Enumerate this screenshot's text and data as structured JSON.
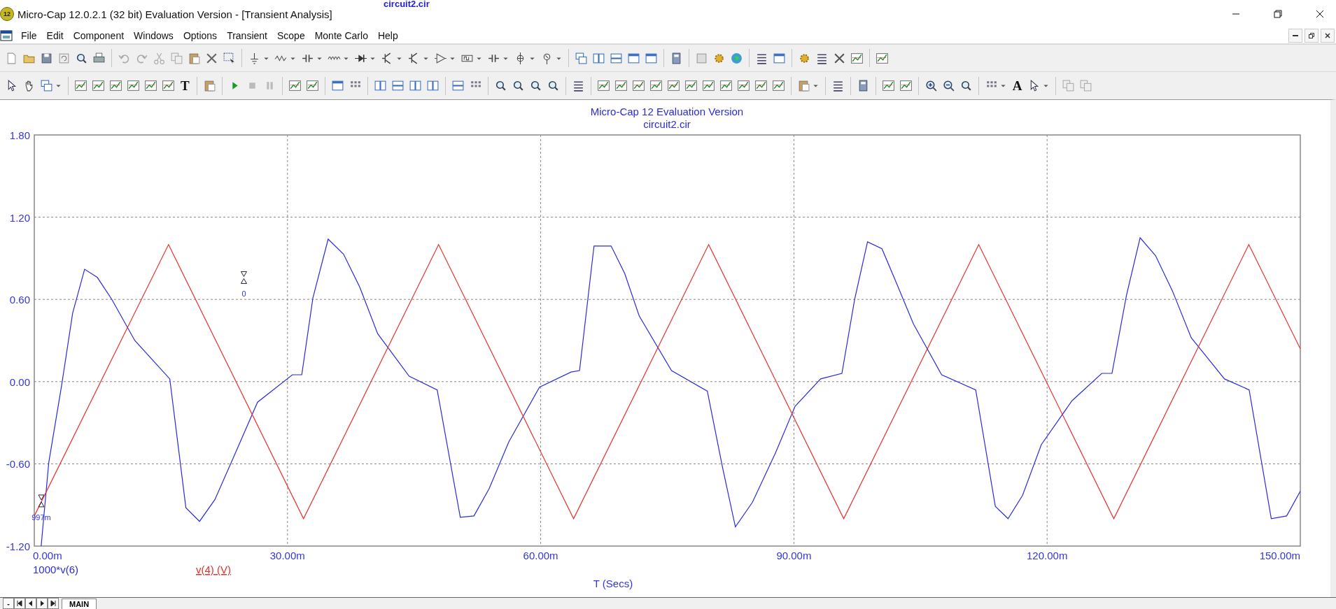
{
  "window": {
    "title": "Micro-Cap 12.0.2.1 (32 bit) Evaluation Version - [Transient Analysis]",
    "icon_label": "12",
    "overflow_text": "circuit2.cir"
  },
  "menu": [
    "File",
    "Edit",
    "Component",
    "Windows",
    "Options",
    "Transient",
    "Scope",
    "Monte Carlo",
    "Help"
  ],
  "toolbar_labels": [
    "T",
    "A"
  ],
  "plot": {
    "title": "Micro-Cap 12 Evaluation Version",
    "subtitle": "circuit2.cir",
    "chart_data": {
      "type": "line",
      "xlabel": "T (Secs)",
      "xlim": [
        0,
        150
      ],
      "ylim": [
        -1.2,
        1.8
      ],
      "xticks": [
        {
          "value": 0,
          "label": "0.00m"
        },
        {
          "value": 30,
          "label": "30.00m"
        },
        {
          "value": 60,
          "label": "60.00m"
        },
        {
          "value": 90,
          "label": "90.00m"
        },
        {
          "value": 120,
          "label": "120.00m"
        },
        {
          "value": 150,
          "label": "150.00m"
        }
      ],
      "yticks": [
        {
          "value": 1.8,
          "label": "1.80"
        },
        {
          "value": 1.2,
          "label": "1.20"
        },
        {
          "value": 0.6,
          "label": "0.60"
        },
        {
          "value": 0,
          "label": "0.00"
        },
        {
          "value": -0.6,
          "label": "-0.60"
        },
        {
          "value": -1.2,
          "label": "-1.20"
        }
      ],
      "series": [
        {
          "name": "1000*v(6)",
          "color": "#2b2bde",
          "x": [
            0.81,
            1.72,
            3.23,
            4.54,
            5.96,
            7.47,
            9.19,
            11.91,
            16.05,
            17.96,
            19.58,
            21.4,
            23.62,
            26.45,
            30.58,
            31.69,
            33.01,
            34.82,
            36.64,
            38.56,
            40.68,
            44.41,
            47.74,
            50.47,
            52.09,
            53.9,
            56.22,
            59.86,
            63.59,
            64.6,
            66.32,
            68.34,
            69.95,
            71.67,
            75.5,
            79.74,
            81.56,
            83.07,
            85.09,
            87.82,
            90.14,
            93.17,
            95.69,
            97.2,
            98.72,
            100.43,
            102.15,
            104.17,
            107.5,
            111.54,
            113.86,
            115.37,
            117.09,
            119.31,
            122.94,
            126.48,
            127.69,
            129.4,
            131.02,
            132.84,
            134.86,
            137.08,
            141.01,
            143.94,
            146.56,
            148.38,
            150
          ],
          "values": [
            -1.2,
            -0.59,
            -0.03,
            0.5,
            0.82,
            0.76,
            0.6,
            0.3,
            0.02,
            -0.92,
            -1.02,
            -0.86,
            -0.55,
            -0.15,
            0.05,
            0.05,
            0.61,
            1.04,
            0.93,
            0.69,
            0.35,
            0.04,
            -0.06,
            -0.99,
            -0.98,
            -0.78,
            -0.44,
            -0.04,
            0.07,
            0.08,
            0.99,
            0.99,
            0.79,
            0.48,
            0.08,
            -0.07,
            -0.63,
            -1.06,
            -0.88,
            -0.52,
            -0.18,
            0.02,
            0.06,
            0.6,
            1.02,
            0.97,
            0.72,
            0.42,
            0.05,
            -0.06,
            -0.91,
            -1.0,
            -0.83,
            -0.46,
            -0.14,
            0.06,
            0.06,
            0.63,
            1.05,
            0.92,
            0.66,
            0.32,
            0.02,
            -0.06,
            -1.0,
            -0.98,
            -0.8
          ]
        },
        {
          "name": "v(4) (V)",
          "color": "#e8302c",
          "x": [
            0,
            15.9,
            31.9,
            47.9,
            63.9,
            79.9,
            95.9,
            111.9,
            127.9,
            143.9,
            150
          ],
          "values": [
            -0.98,
            1,
            -1,
            1,
            -1,
            1,
            -1,
            1,
            -1,
            1,
            0.24
          ]
        }
      ],
      "grid": true,
      "annotations": [
        "0",
        "997m"
      ]
    }
  },
  "tabs": [
    {
      "label": "MAIN",
      "selected": true
    }
  ]
}
